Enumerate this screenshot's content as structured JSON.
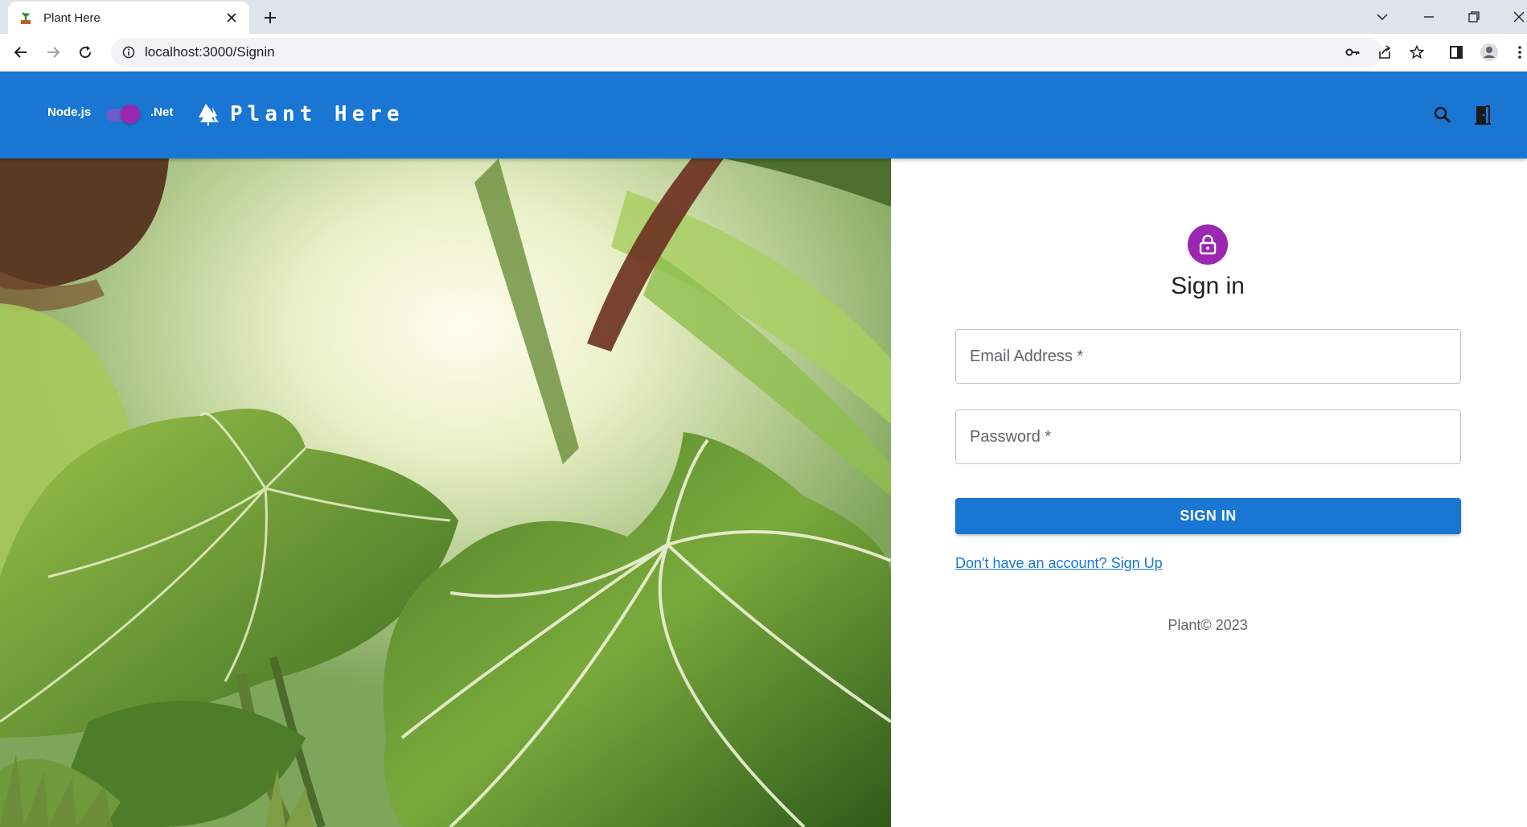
{
  "browser": {
    "tab_title": "Plant Here",
    "url": "localhost:3000/Signin"
  },
  "appbar": {
    "left_label": "Node.js",
    "right_label": ".Net",
    "brand": "Plant Here",
    "toggle_on": true
  },
  "signin": {
    "heading": "Sign in",
    "email_label": "Email Address *",
    "email_value": "",
    "password_label": "Password *",
    "password_value": "",
    "button_label": "SIGN IN",
    "signup_link": "Don't have an account? Sign Up",
    "copyright": "Plant© 2023"
  },
  "colors": {
    "primary": "#1976d2",
    "secondary": "#9c27b0"
  }
}
